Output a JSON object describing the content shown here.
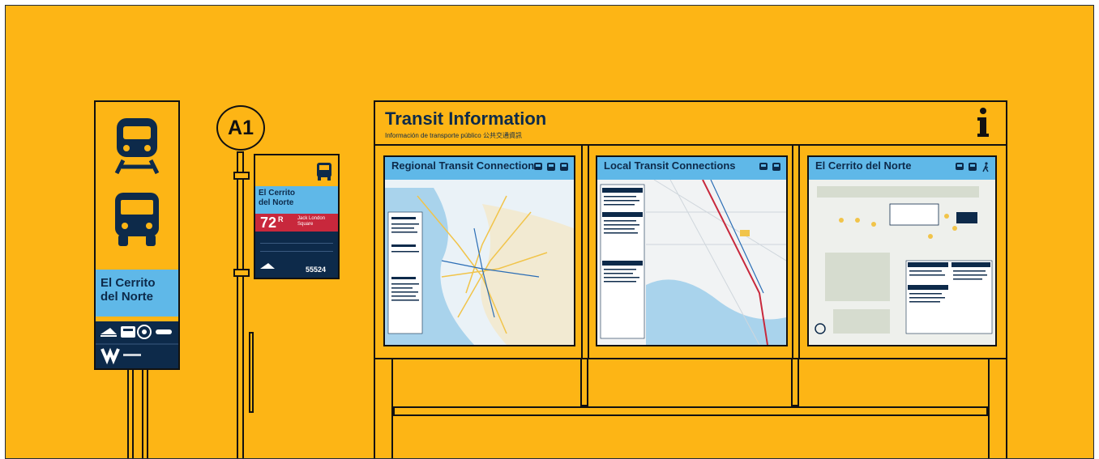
{
  "tall_sign": {
    "station_name": "El Cerrito\ndel Norte",
    "icons": [
      "train-icon",
      "bus-icon"
    ],
    "logos": [
      "ac-transit-logo",
      "bart-logo",
      "caltrans-seal-logo",
      "delnorte-logo",
      "westcat-logo"
    ]
  },
  "bus_stop": {
    "stop_id": "A1",
    "station_name": "El Cerrito\ndel Norte",
    "route_number": "72",
    "route_suffix": "R",
    "destination": "Jack London\nSquare",
    "stop_code": "55524",
    "icon": "bus-icon"
  },
  "kiosk": {
    "title": "Transit Information",
    "subtitle": "Información de transporte público  公共交通資訊",
    "info_icon": "info-icon",
    "panels": [
      {
        "title": "Regional Transit Connections",
        "icons": [
          "train-icon",
          "bus-icon",
          "bus-icon"
        ]
      },
      {
        "title": "Local Transit Connections",
        "icons": [
          "train-icon",
          "bus-icon"
        ]
      },
      {
        "title": "El Cerrito del Norte",
        "icons": [
          "train-icon",
          "bus-icon",
          "walking-icon"
        ]
      }
    ]
  },
  "colors": {
    "background": "#FDB515",
    "navy": "#0d2a4a",
    "sky": "#5fb8e8",
    "route_red": "#c8283c"
  }
}
